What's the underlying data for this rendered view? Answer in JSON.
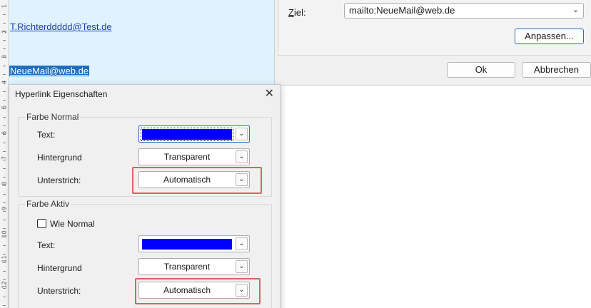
{
  "document": {
    "link1": "T.Richterddddd@Test.de",
    "link2": "NeueMail@web.de",
    "ruler_numbers": [
      "1",
      "2",
      "3",
      "4",
      "5",
      "6",
      "7",
      "8",
      "9",
      "10",
      "11",
      "12"
    ]
  },
  "target_dialog": {
    "ziel_label": "Ziel:",
    "ziel_value": "mailto:NeueMail@web.de",
    "customize_button": "Anpassen...",
    "ok_button": "Ok",
    "cancel_button": "Abbrechen"
  },
  "hyperlink_dialog": {
    "title": "Hyperlink Eigenschaften",
    "close_glyph": "✕",
    "normal_group": {
      "title": "Farbe Normal",
      "text_label": "Text:",
      "text_color": "#0000ff",
      "background_label": "Hintergrund",
      "background_value": "Transparent",
      "underline_label": "Unterstrich:",
      "underline_value": "Automatisch"
    },
    "active_group": {
      "title": "Farbe Aktiv",
      "same_as_normal_label": "Wie Normal",
      "same_as_normal_checked": false,
      "text_label": "Text:",
      "text_color": "#0000ff",
      "background_label": "Hintergrund",
      "background_value": "Transparent",
      "underline_label": "Unterstrich:",
      "underline_value": "Automatisch"
    }
  },
  "colors": {
    "highlight_box": "#e06060",
    "accent": "#2b6cc4",
    "doc_background": "#dff2fd"
  }
}
